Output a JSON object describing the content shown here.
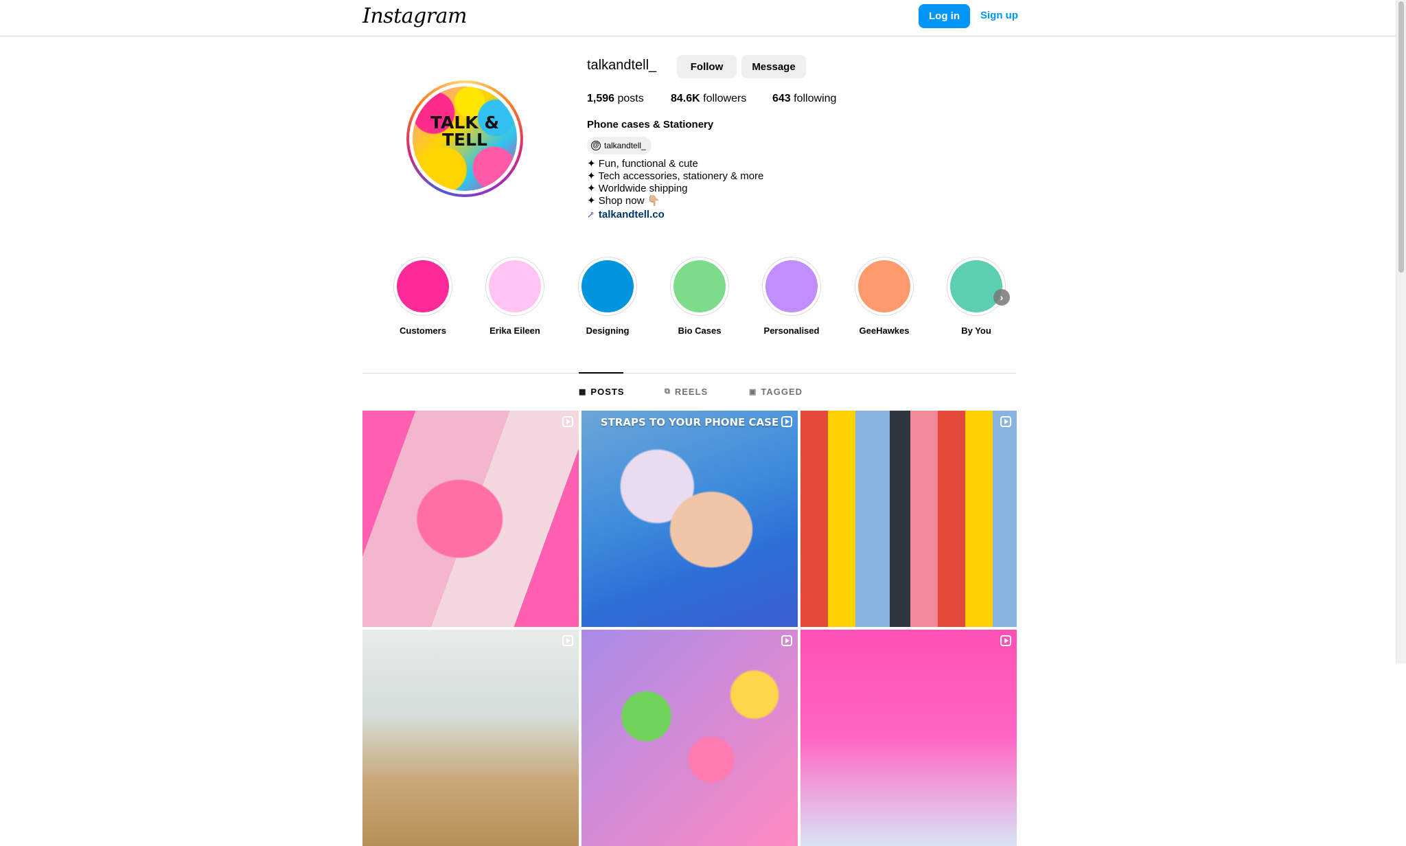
{
  "topnav": {
    "logo": "Instagram",
    "login_label": "Log in",
    "signup_label": "Sign up"
  },
  "profile": {
    "avatar_text": "TALK & TELL",
    "username": "talkandtell_",
    "follow_label": "Follow",
    "message_label": "Message",
    "stats": [
      {
        "count": "1,596",
        "label": "posts"
      },
      {
        "count": "84.6K",
        "label": "followers"
      },
      {
        "count": "643",
        "label": "following"
      }
    ],
    "full_name": "Phone cases & Stationery",
    "threads_handle": "talkandtell_",
    "bio": [
      "✦ Fun, functional & cute",
      "✦ Tech accessories, stationery & more",
      "✦ Worldwide shipping",
      "✦ Shop now 👇🏼"
    ],
    "link": "talkandtell.co"
  },
  "highlights": [
    {
      "label": "Customers",
      "color": "#ff2a9a"
    },
    {
      "label": "Erika Eileen",
      "color": "#ffc4f2"
    },
    {
      "label": "Designing",
      "color": "#0095dd"
    },
    {
      "label": "Bio Cases",
      "color": "#7ddc8c"
    },
    {
      "label": "Personalised",
      "color": "#c28dff"
    },
    {
      "label": "GeeHawkes",
      "color": "#ff9a6e"
    },
    {
      "label": "By You",
      "color": "#5ccfb0"
    }
  ],
  "tabs": [
    {
      "label": "POSTS",
      "icon": "grid-icon",
      "active": true
    },
    {
      "label": "REELS",
      "icon": "reels-icon",
      "active": false
    },
    {
      "label": "TAGGED",
      "icon": "tagged-icon",
      "active": false
    }
  ],
  "posts": [
    {
      "caption": "",
      "type": "reel"
    },
    {
      "caption": "STRAPS TO YOUR PHONE CASE",
      "type": "reel"
    },
    {
      "caption": "",
      "type": "carousel"
    },
    {
      "caption": "",
      "type": "reel"
    },
    {
      "caption": "",
      "type": "carousel"
    },
    {
      "caption": "",
      "type": "reel"
    }
  ],
  "colors": {
    "accent": "#0095f6",
    "link": "#00376b",
    "button_secondary": "#efefef",
    "divider": "#dbdbdb"
  }
}
